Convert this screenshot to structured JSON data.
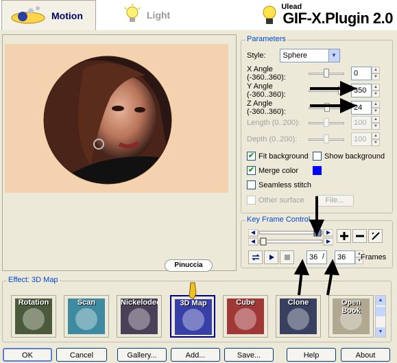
{
  "tabs": [
    {
      "label": "Motion",
      "active": true
    },
    {
      "label": "Light",
      "active": false
    }
  ],
  "brand": {
    "small": "Ulead",
    "title": "GIF-X.Plugin 2.0"
  },
  "watermark": "Pinuccia",
  "parameters": {
    "legend": "Parameters",
    "style_label": "Style:",
    "style_value": "Sphere",
    "rows": [
      {
        "label": "X Angle (-360..360):",
        "value": "0",
        "slider": 0.5,
        "disabled": false
      },
      {
        "label": "Y Angle (-360..360):",
        "value": "350",
        "slider": 0.98,
        "disabled": false
      },
      {
        "label": "Z Angle (-360..360):",
        "value": "24",
        "slider": 0.53,
        "disabled": false
      },
      {
        "label": "Length (0..200):",
        "value": "100",
        "slider": 0.5,
        "disabled": true
      },
      {
        "label": "Depth (0..200):",
        "value": "100",
        "slider": 0.5,
        "disabled": true
      }
    ],
    "checks": {
      "fit_background": {
        "label": "Fit background",
        "checked": true
      },
      "show_background": {
        "label": "Show background",
        "checked": false
      },
      "merge_color": {
        "label": "Merge color",
        "checked": true
      },
      "seamless_stitch": {
        "label": "Seamless stitch",
        "checked": false
      },
      "other_surface": {
        "label": "Other surface",
        "checked": false,
        "disabled": true
      }
    },
    "merge_color_value": "#0000ff",
    "file_button": "File..."
  },
  "keyframe": {
    "legend": "Key Frame Control",
    "current_frame": "36",
    "total_frames": "36",
    "slash": "/",
    "frames_label": "Frames"
  },
  "effects": {
    "legend": "Effect: 3D Map",
    "items": [
      {
        "label": "Rotation",
        "selected": false,
        "color": "#4a5a3a"
      },
      {
        "label": "Scan",
        "selected": false,
        "color": "#3e8aa0"
      },
      {
        "label": "Nickelodeon",
        "selected": false,
        "color": "#4a4058"
      },
      {
        "label": "3D Map",
        "selected": true,
        "color": "#3840a8"
      },
      {
        "label": "Cube",
        "selected": false,
        "color": "#a03838"
      },
      {
        "label": "Clone",
        "selected": false,
        "color": "#384060"
      },
      {
        "label": "Open Book",
        "selected": false,
        "color": "#b0a890"
      }
    ]
  },
  "footer": {
    "ok": "OK",
    "cancel": "Cancel",
    "gallery": "Gallery...",
    "add": "Add...",
    "save": "Save...",
    "help": "Help",
    "about": "About"
  }
}
